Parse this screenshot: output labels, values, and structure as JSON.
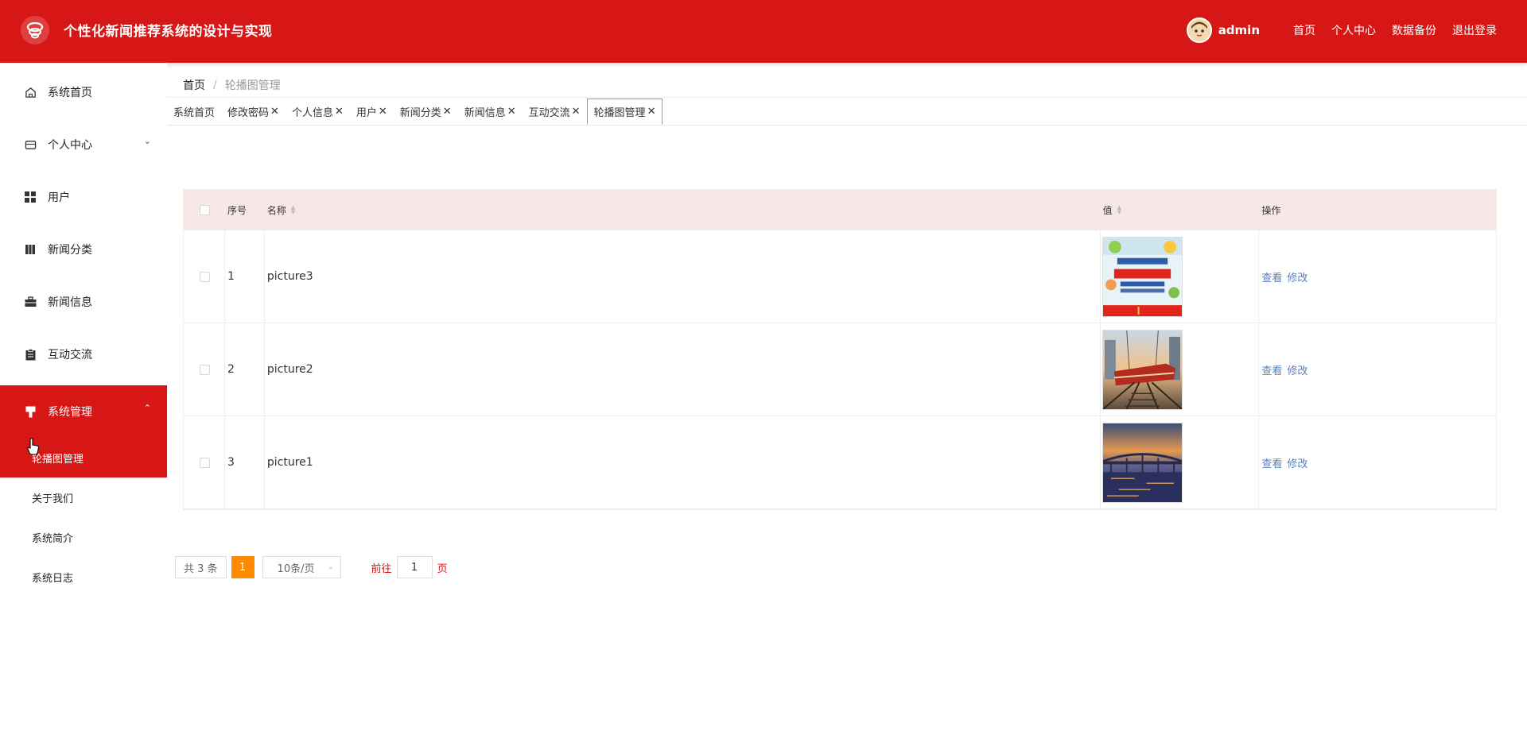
{
  "header": {
    "title": "个性化新闻推荐系统的设计与实现",
    "username": "admin",
    "links": [
      "首页",
      "个人中心",
      "数据备份",
      "退出登录"
    ],
    "accent_color": "#d71616"
  },
  "sidebar": {
    "items": [
      {
        "label": "系统首页",
        "icon": "home-icon"
      },
      {
        "label": "个人中心",
        "icon": "wallet-icon",
        "chevron": "down"
      },
      {
        "label": "用户",
        "icon": "grid-icon"
      },
      {
        "label": "新闻分类",
        "icon": "book-icon"
      },
      {
        "label": "新闻信息",
        "icon": "briefcase-icon"
      },
      {
        "label": "互动交流",
        "icon": "clipboard-icon"
      },
      {
        "label": "系统管理",
        "icon": "brush-icon",
        "chevron": "up",
        "active": true
      }
    ],
    "sub_items": [
      "轮播图管理",
      "关于我们",
      "系统简介",
      "系统日志"
    ]
  },
  "breadcrumb": {
    "home": "首页",
    "separator": "/",
    "current": "轮播图管理"
  },
  "tabs": [
    {
      "label": "系统首页",
      "closable": false
    },
    {
      "label": "修改密码",
      "closable": true
    },
    {
      "label": "个人信息",
      "closable": true
    },
    {
      "label": "用户",
      "closable": true
    },
    {
      "label": "新闻分类",
      "closable": true
    },
    {
      "label": "新闻信息",
      "closable": true
    },
    {
      "label": "互动交流",
      "closable": true
    },
    {
      "label": "轮播图管理",
      "closable": true,
      "active": true
    }
  ],
  "table": {
    "headers": {
      "index": "序号",
      "name": "名称",
      "value": "值",
      "actions": "操作"
    },
    "rows": [
      {
        "index": "1",
        "name": "picture3",
        "thumb": "poster-image"
      },
      {
        "index": "2",
        "name": "picture2",
        "thumb": "train-image"
      },
      {
        "index": "3",
        "name": "picture1",
        "thumb": "bridge-image"
      }
    ],
    "actions": {
      "view": "查看",
      "edit": "修改"
    },
    "header_bg": "#f8e7e7"
  },
  "pagination": {
    "total": "共 3 条",
    "current_page": "1",
    "page_size": "10条/页",
    "goto_label": "前往",
    "goto_value": "1",
    "goto_suffix": "页",
    "active_color": "#ff8a00"
  }
}
